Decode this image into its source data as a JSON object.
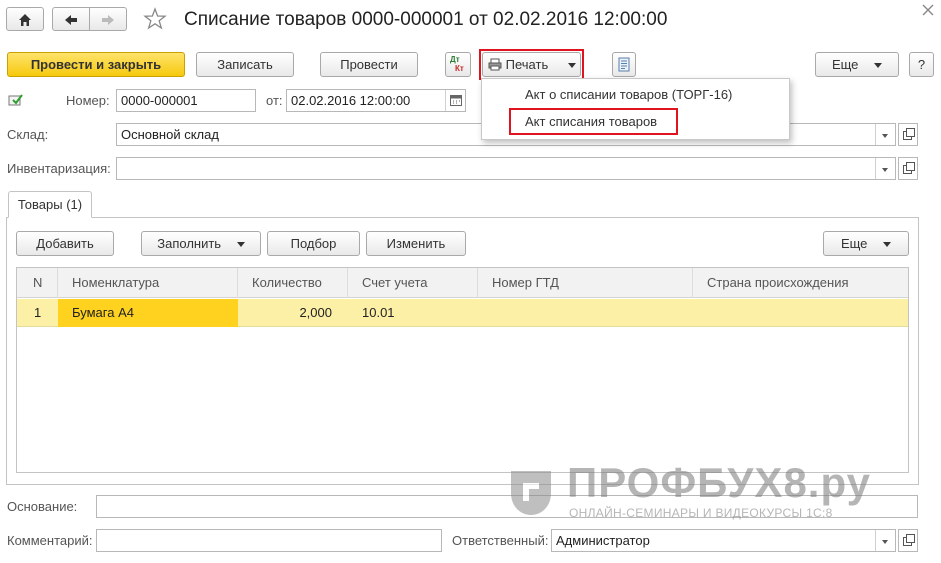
{
  "window": {
    "title": "Списание товаров 0000-000001 от 02.02.2016 12:00:00"
  },
  "toolbar": {
    "post_close_label": "Провести и закрыть",
    "save_label": "Записать",
    "post_label": "Провести",
    "dt_kt_top": "Дт",
    "dt_kt_bottom": "Кт",
    "print_label": "Печать",
    "more_label": "Еще",
    "help_label": "?"
  },
  "print_menu": {
    "items": [
      "Акт о списании товаров (ТОРГ-16)",
      "Акт списания товаров"
    ]
  },
  "header": {
    "number_label": "Номер:",
    "number_value": "0000-000001",
    "date_label": "от:",
    "date_value": "02.02.2016 12:00:00",
    "warehouse_label": "Склад:",
    "warehouse_value": "Основной склад",
    "inventory_label": "Инвентаризация:",
    "inventory_value": ""
  },
  "tabs": [
    {
      "label": "Товары (1)"
    }
  ],
  "table_toolbar": {
    "add_label": "Добавить",
    "fill_label": "Заполнить",
    "select_label": "Подбор",
    "change_label": "Изменить",
    "more_label": "Еще"
  },
  "table": {
    "columns": [
      "N",
      "Номенклатура",
      "Количество",
      "Счет учета",
      "Номер ГТД",
      "Страна происхождения"
    ],
    "rows": [
      {
        "n": "1",
        "item": "Бумага А4",
        "qty": "2,000",
        "account": "10.01",
        "gtd": "",
        "country": ""
      }
    ]
  },
  "footer": {
    "basis_label": "Основание:",
    "basis_value": "",
    "comment_label": "Комментарий:",
    "comment_value": "",
    "responsible_label": "Ответственный:",
    "responsible_value": "Администратор"
  },
  "watermark": {
    "brand": "ПРОФБУХ8.ру",
    "tagline": "ОНЛАЙН-СЕМИНАРЫ И ВИДЕОКУРСЫ 1С:8"
  },
  "colors": {
    "primary_button": "#f6c90e",
    "selected_row": "#fbf0a6",
    "selected_cell": "#ffd21f",
    "highlight_border": "#e0141e"
  },
  "icons": [
    "home-icon",
    "back-arrow-icon",
    "forward-arrow-icon",
    "star-icon",
    "close-icon",
    "printer-icon",
    "document-icon",
    "calendar-icon",
    "posted-status-icon",
    "dt-kt-icon"
  ]
}
